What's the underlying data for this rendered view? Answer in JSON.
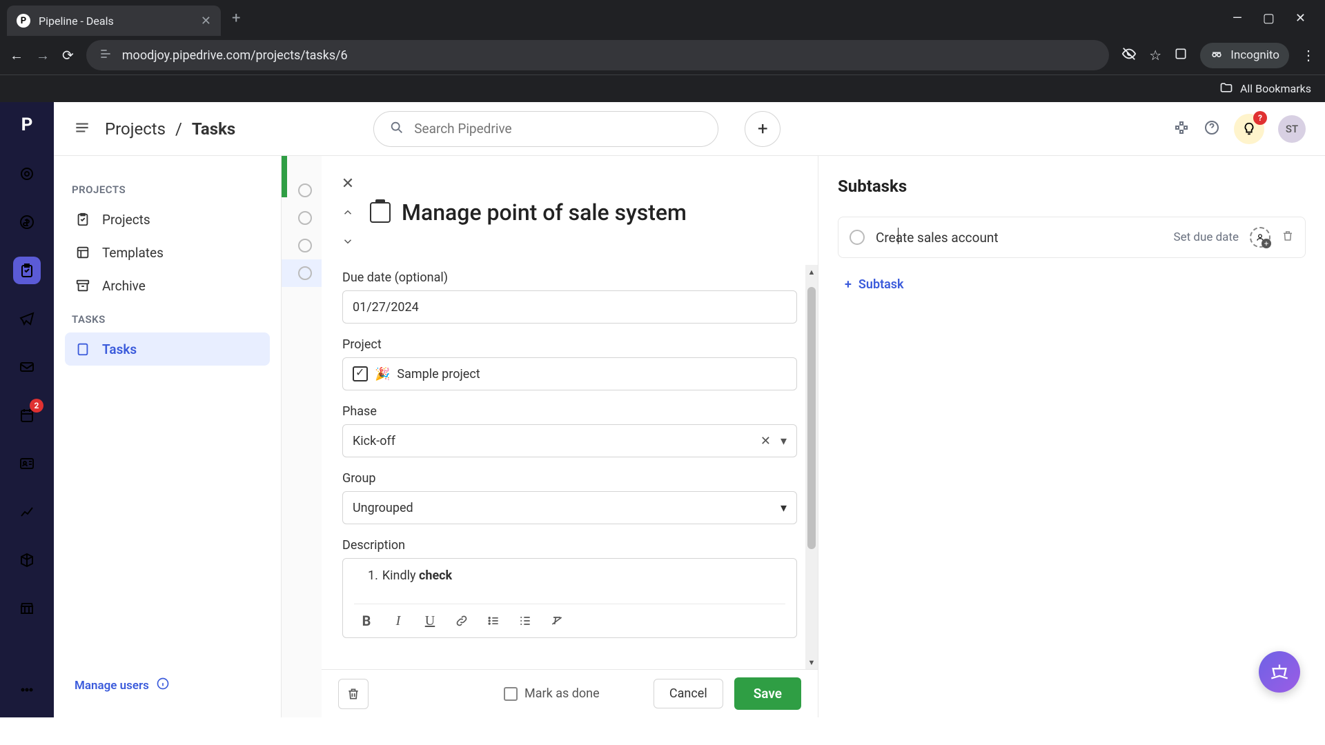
{
  "browser": {
    "tab_title": "Pipeline - Deals",
    "url": "moodjoy.pipedrive.com/projects/tasks/6",
    "incognito_label": "Incognito",
    "all_bookmarks": "All Bookmarks"
  },
  "header": {
    "breadcrumb_root": "Projects",
    "breadcrumb_current": "Tasks",
    "search_placeholder": "Search Pipedrive",
    "avatar_initials": "ST",
    "bulb_badge": "?"
  },
  "rail": {
    "badge_count": "2"
  },
  "sidebar": {
    "section_projects": "PROJECTS",
    "items": [
      {
        "label": "Projects"
      },
      {
        "label": "Templates"
      },
      {
        "label": "Archive"
      }
    ],
    "section_tasks": "TASKS",
    "tasks_label": "Tasks",
    "manage_users": "Manage users"
  },
  "modal": {
    "title": "Manage point of sale system",
    "due_label": "Due date (optional)",
    "due_value": "01/27/2024",
    "project_label": "Project",
    "project_value": "Sample project",
    "phase_label": "Phase",
    "phase_value": "Kick-off",
    "group_label": "Group",
    "group_value": "Ungrouped",
    "description_label": "Description",
    "desc_number": "1.",
    "desc_prefix": "Kindly ",
    "desc_bold": "check",
    "mark_done": "Mark as done",
    "cancel": "Cancel",
    "save": "Save"
  },
  "subtasks": {
    "title": "Subtasks",
    "item_text": "Create sales account",
    "set_due": "Set due date",
    "add_label": "Subtask"
  }
}
